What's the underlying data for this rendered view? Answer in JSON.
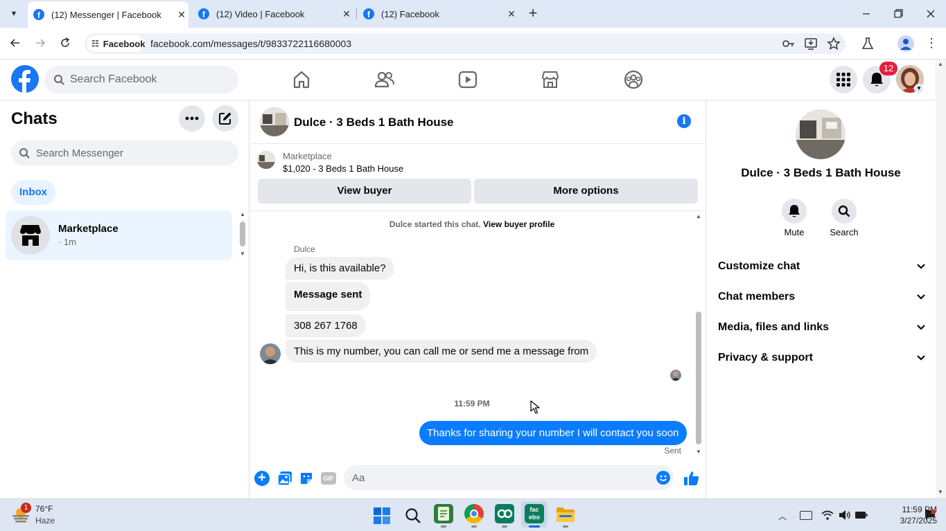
{
  "browser": {
    "tabs": [
      {
        "title": "(12) Messenger | Facebook",
        "active": true
      },
      {
        "title": "(12) Video | Facebook",
        "active": false
      },
      {
        "title": "(12) Facebook",
        "active": false
      }
    ],
    "site_chip": "Facebook",
    "url": "facebook.com/messages/t/9833722116680003"
  },
  "fb": {
    "search_placeholder": "Search Facebook",
    "notification_count": "12",
    "accent": "#1877f2"
  },
  "left": {
    "title": "Chats",
    "search_placeholder": "Search Messenger",
    "filter_inbox": "Inbox",
    "chats": [
      {
        "name": "Marketplace",
        "meta": "· 1m"
      }
    ]
  },
  "conversation": {
    "title": "Dulce · 3 Beds 1 Bath House",
    "listing_source": "Marketplace",
    "listing_title": "$1,020 - 3 Beds 1 Bath House",
    "view_buyer": "View buyer",
    "more_options": "More options",
    "started_text": "Dulce started this chat.",
    "view_buyer_profile": "View buyer profile",
    "sender_name": "Dulce",
    "incoming": [
      "Hi, is this available?",
      "Message sent",
      "308 267 1768",
      "This is my number, you can call me or send me a message from"
    ],
    "timestamp": "11:59 PM",
    "outgoing": "Thanks for sharing your number I will contact you soon",
    "sent_status": "Sent",
    "composer_placeholder": "Aa"
  },
  "right": {
    "name": "Dulce · 3 Beds 1 Bath House",
    "mute": "Mute",
    "search": "Search",
    "sections": [
      "Customize chat",
      "Chat members",
      "Media, files and links",
      "Privacy & support"
    ]
  },
  "taskbar": {
    "weather_temp": "76°F",
    "weather_desc": "Haze",
    "weather_badge": "1",
    "time": "11:59 PM",
    "date": "3/27/2025"
  }
}
